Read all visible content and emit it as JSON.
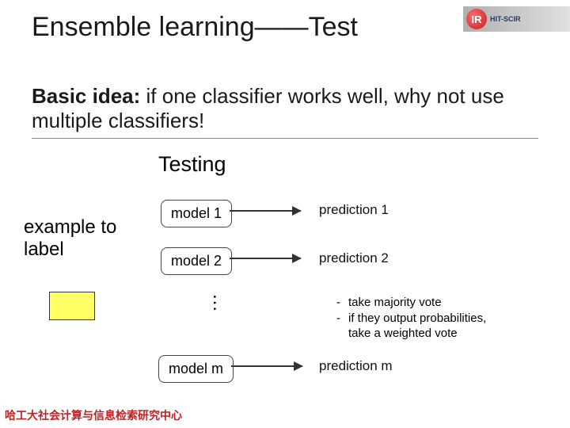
{
  "header": {
    "logo_initials": "IR",
    "logo_label": "HIT-SCIR"
  },
  "title": "Ensemble learning——Test",
  "subtitle": {
    "bold": "Basic idea:",
    "rest": " if one classifier works well, why not use multiple classifiers!"
  },
  "testing_header": "Testing",
  "example_label_line1": "example to",
  "example_label_line2": "label",
  "models": {
    "m1": "model 1",
    "m2": "model 2",
    "mm": "model m"
  },
  "dots": "…",
  "predictions": {
    "p1": "prediction 1",
    "p2": "prediction 2",
    "pm": "prediction m"
  },
  "notes": {
    "n1": "take majority vote",
    "n2a": "if they output probabilities,",
    "n2b": "take a weighted vote",
    "dash": "-"
  },
  "footer": "哈工大社会计算与信息检索研究中心"
}
